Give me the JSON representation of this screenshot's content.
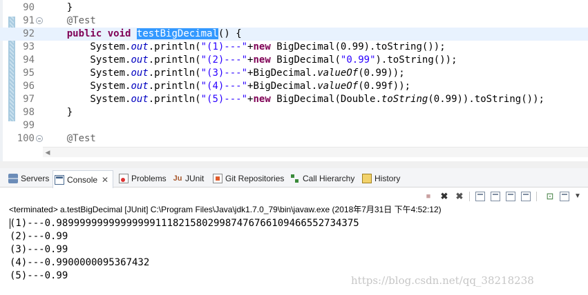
{
  "editor": {
    "lines": [
      {
        "number": "90",
        "fold": false,
        "current": false,
        "tokens": [
          {
            "t": "    }",
            "c": ""
          }
        ]
      },
      {
        "number": "91",
        "fold": true,
        "current": false,
        "tokens": [
          {
            "t": "    ",
            "c": ""
          },
          {
            "t": "@Test",
            "c": "ann"
          }
        ]
      },
      {
        "number": "92",
        "fold": false,
        "current": true,
        "tokens": [
          {
            "t": "    ",
            "c": ""
          },
          {
            "t": "public",
            "c": "kw"
          },
          {
            "t": " ",
            "c": ""
          },
          {
            "t": "void",
            "c": "kw"
          },
          {
            "t": " ",
            "c": ""
          },
          {
            "t": "testBigDecimal",
            "c": "sel"
          },
          {
            "t": "() {",
            "c": ""
          }
        ]
      },
      {
        "number": "93",
        "fold": false,
        "current": false,
        "tokens": [
          {
            "t": "        System.",
            "c": ""
          },
          {
            "t": "out",
            "c": "field"
          },
          {
            "t": ".println(",
            "c": ""
          },
          {
            "t": "\"(1)---\"",
            "c": "str"
          },
          {
            "t": "+",
            "c": ""
          },
          {
            "t": "new",
            "c": "kw"
          },
          {
            "t": " BigDecimal(0.99).toString());",
            "c": ""
          }
        ]
      },
      {
        "number": "94",
        "fold": false,
        "current": false,
        "tokens": [
          {
            "t": "        System.",
            "c": ""
          },
          {
            "t": "out",
            "c": "field"
          },
          {
            "t": ".println(",
            "c": ""
          },
          {
            "t": "\"(2)---\"",
            "c": "str"
          },
          {
            "t": "+",
            "c": ""
          },
          {
            "t": "new",
            "c": "kw"
          },
          {
            "t": " BigDecimal(",
            "c": ""
          },
          {
            "t": "\"0.99\"",
            "c": "str"
          },
          {
            "t": ").toString());",
            "c": ""
          }
        ]
      },
      {
        "number": "95",
        "fold": false,
        "current": false,
        "tokens": [
          {
            "t": "        System.",
            "c": ""
          },
          {
            "t": "out",
            "c": "field"
          },
          {
            "t": ".println(",
            "c": ""
          },
          {
            "t": "\"(3)---\"",
            "c": "str"
          },
          {
            "t": "+BigDecimal.",
            "c": ""
          },
          {
            "t": "valueOf",
            "c": "static"
          },
          {
            "t": "(0.99));",
            "c": ""
          }
        ]
      },
      {
        "number": "96",
        "fold": false,
        "current": false,
        "tokens": [
          {
            "t": "        System.",
            "c": ""
          },
          {
            "t": "out",
            "c": "field"
          },
          {
            "t": ".println(",
            "c": ""
          },
          {
            "t": "\"(4)---\"",
            "c": "str"
          },
          {
            "t": "+BigDecimal.",
            "c": ""
          },
          {
            "t": "valueOf",
            "c": "static"
          },
          {
            "t": "(0.99f));",
            "c": ""
          }
        ]
      },
      {
        "number": "97",
        "fold": false,
        "current": false,
        "tokens": [
          {
            "t": "        System.",
            "c": ""
          },
          {
            "t": "out",
            "c": "field"
          },
          {
            "t": ".println(",
            "c": ""
          },
          {
            "t": "\"(5)---\"",
            "c": "str"
          },
          {
            "t": "+",
            "c": ""
          },
          {
            "t": "new",
            "c": "kw"
          },
          {
            "t": " BigDecimal(Double.",
            "c": ""
          },
          {
            "t": "toString",
            "c": "static"
          },
          {
            "t": "(0.99)).toString());",
            "c": ""
          }
        ]
      },
      {
        "number": "98",
        "fold": false,
        "current": false,
        "tokens": [
          {
            "t": "    }",
            "c": ""
          }
        ]
      },
      {
        "number": "99",
        "fold": false,
        "current": false,
        "tokens": [
          {
            "t": "",
            "c": ""
          }
        ]
      },
      {
        "number": "100",
        "fold": true,
        "current": false,
        "tokens": [
          {
            "t": "    ",
            "c": ""
          },
          {
            "t": "@Test",
            "c": "ann"
          }
        ]
      }
    ]
  },
  "tabs": [
    {
      "id": "servers",
      "label": "Servers",
      "icon": "servers-icon"
    },
    {
      "id": "console",
      "label": "Console",
      "icon": "console-icon",
      "active": true,
      "close": "✕"
    },
    {
      "id": "problems",
      "label": "Problems",
      "icon": "problems-icon"
    },
    {
      "id": "junit",
      "label": "JUnit",
      "icon": "junit-icon",
      "glyph": "Ju"
    },
    {
      "id": "git",
      "label": "Git Repositories",
      "icon": "git-icon"
    },
    {
      "id": "hierarchy",
      "label": "Call Hierarchy",
      "icon": "call-hierarchy-icon"
    },
    {
      "id": "history",
      "label": "History",
      "icon": "history-icon"
    }
  ],
  "console": {
    "status": "<terminated> a.testBigDecimal [JUnit] C:\\Program Files\\Java\\jdk1.7.0_79\\bin\\javaw.exe (2018年7月31日 下午4:52:12)",
    "output": [
      "(1)---0.9899999999999999911182158029987476766109466552734375",
      "(2)---0.99",
      "(3)---0.99",
      "(4)---0.9900000095367432",
      "(5)---0.99"
    ]
  },
  "toolbar": {
    "stop_glyph": "■",
    "remove_glyph": "✖",
    "remove_all_glyph": "✖",
    "pin_glyph": "⊡",
    "menu_glyph": "▼"
  },
  "watermark": "https://blog.csdn.net/qq_38218238",
  "scroll_arrow": "◀"
}
